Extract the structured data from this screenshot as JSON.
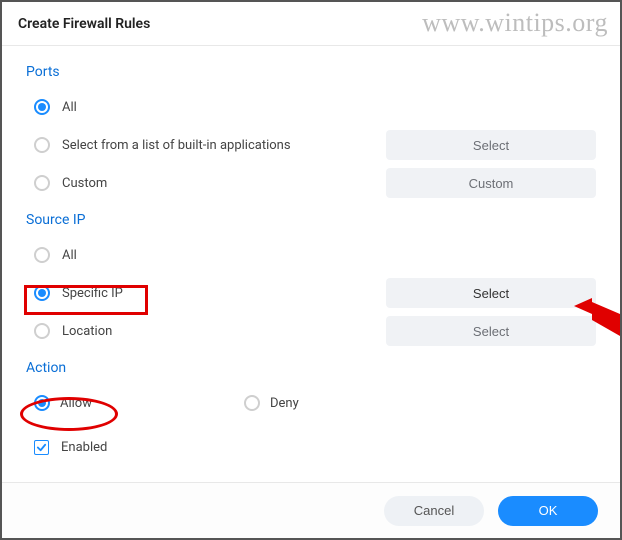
{
  "window": {
    "title": "Create Firewall Rules"
  },
  "watermark": "www.wintips.org",
  "sections": {
    "ports": {
      "title": "Ports",
      "options": {
        "all": "All",
        "list": "Select from a list of built-in applications",
        "custom": "Custom"
      },
      "buttons": {
        "list_select": "Select",
        "custom_select": "Custom"
      }
    },
    "source_ip": {
      "title": "Source IP",
      "options": {
        "all": "All",
        "specific": "Specific IP",
        "location": "Location"
      },
      "buttons": {
        "specific_select": "Select",
        "location_select": "Select"
      }
    },
    "action": {
      "title": "Action",
      "options": {
        "allow": "Allow",
        "deny": "Deny"
      },
      "enabled_label": "Enabled"
    }
  },
  "footer": {
    "cancel": "Cancel",
    "ok": "OK"
  }
}
